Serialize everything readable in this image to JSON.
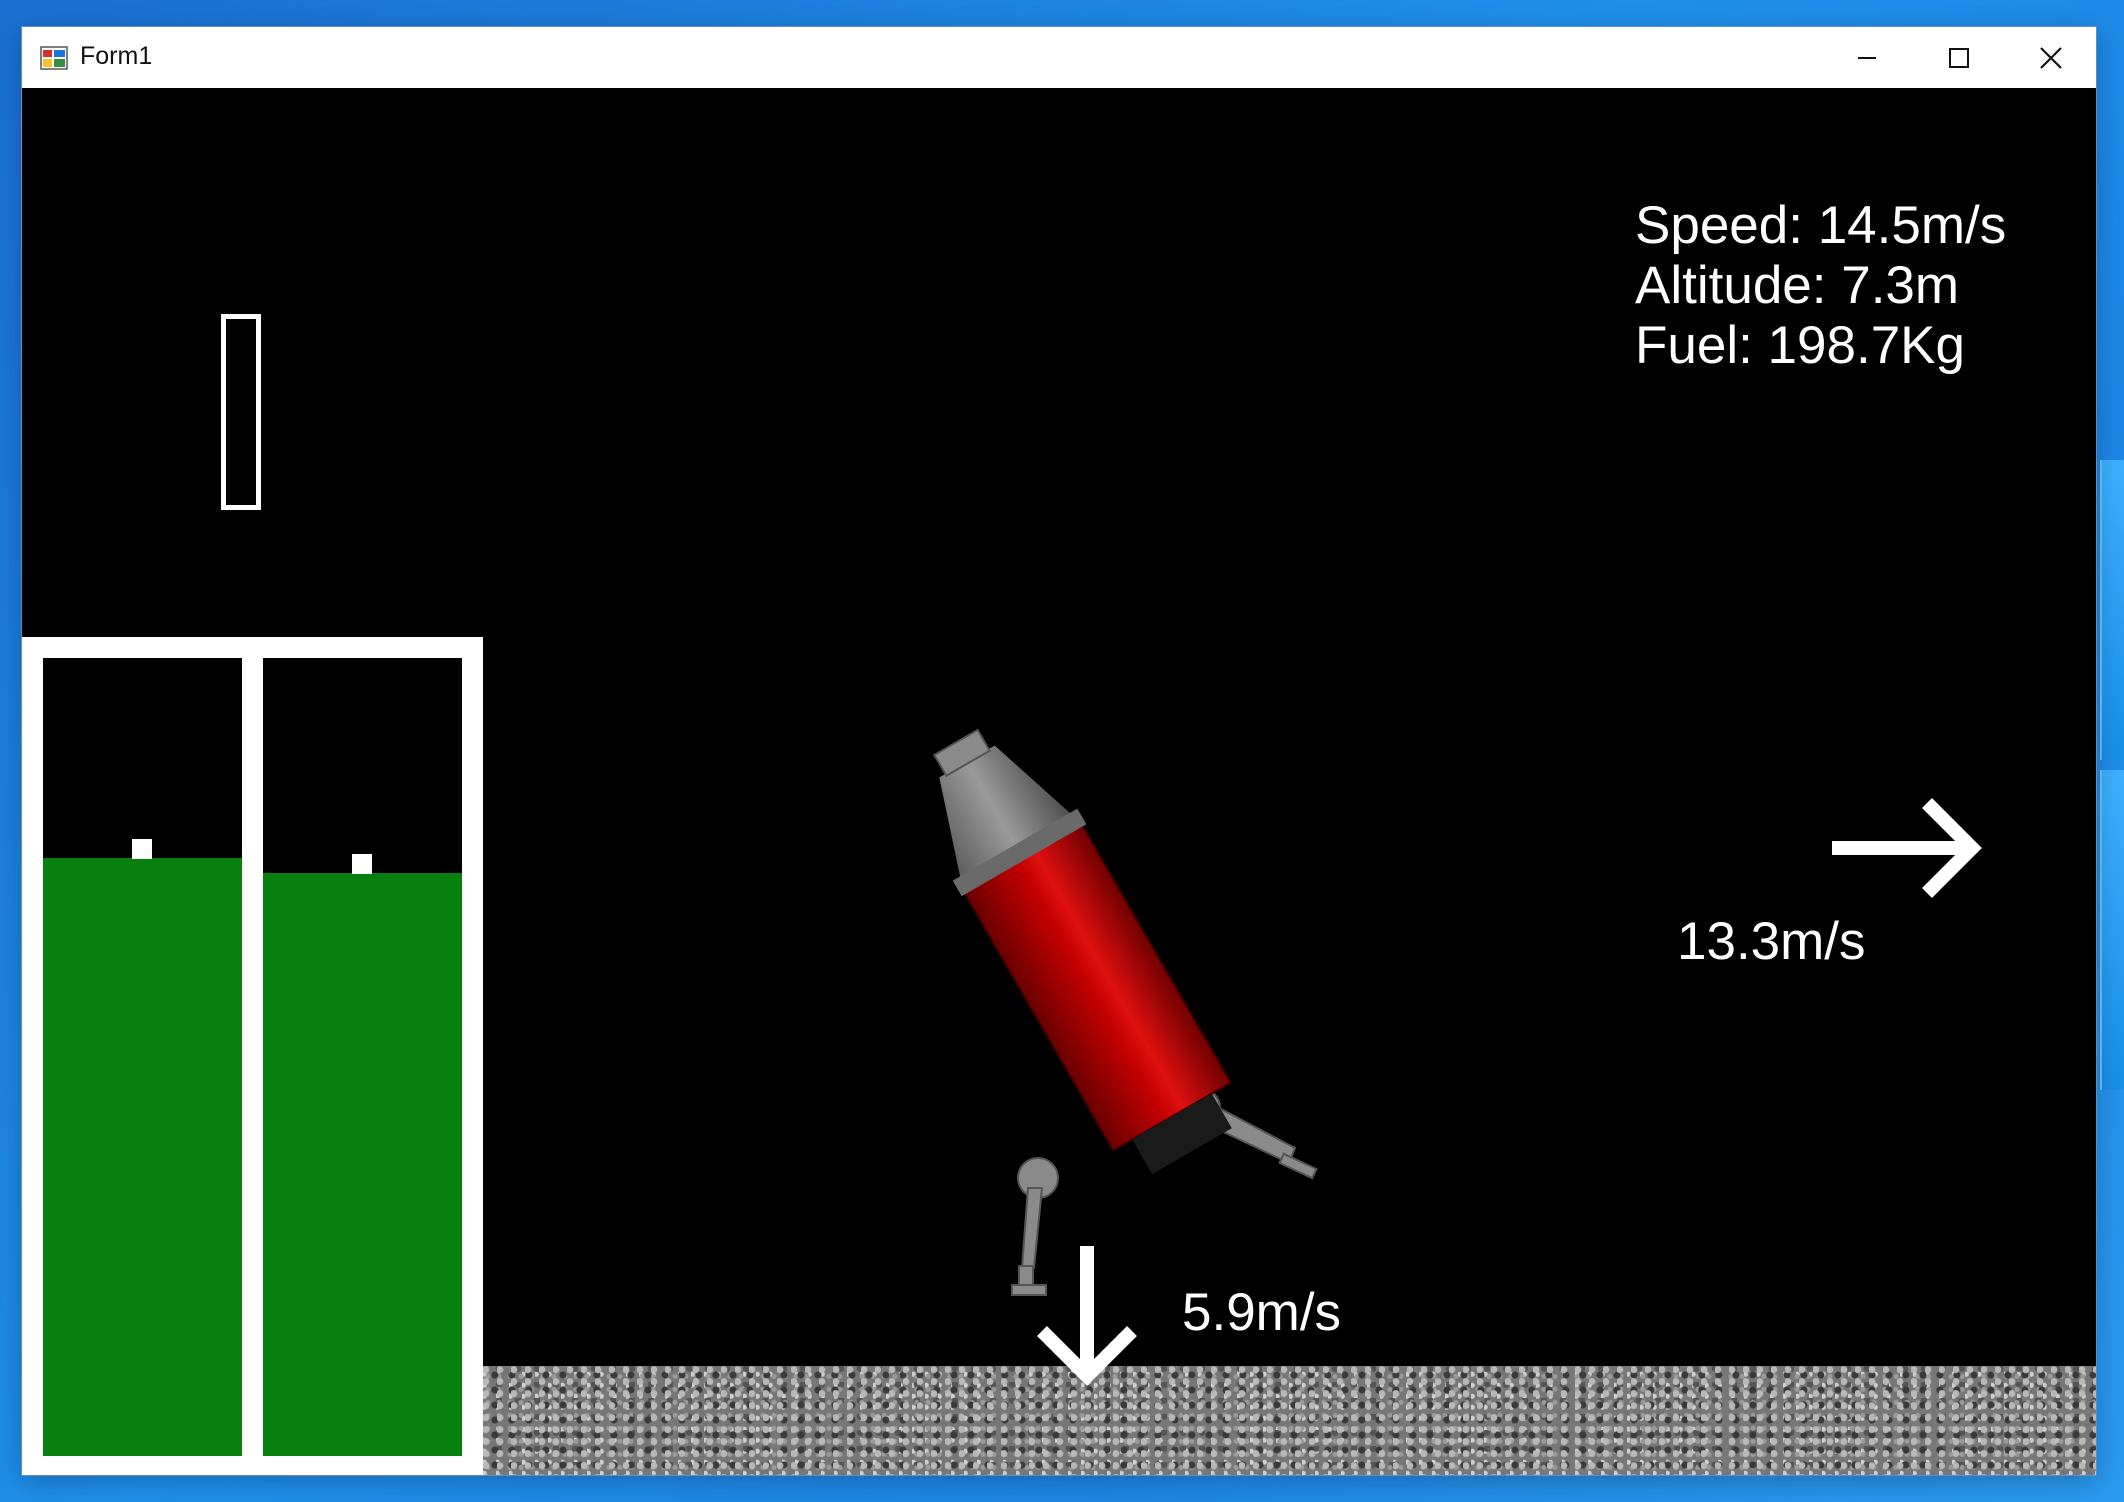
{
  "window": {
    "title": "Form1",
    "controls": {
      "minimize": "minimize",
      "maximize": "maximize",
      "close": "close"
    }
  },
  "hud": {
    "speed": "Speed: 14.5m/s",
    "altitude": "Altitude: 7.3m",
    "fuel": "Fuel: 198.7Kg"
  },
  "velocity": {
    "horizontal_label": "13.3m/s",
    "vertical_label": "5.9m/s"
  },
  "tanks": [
    {
      "name": "left-tank",
      "level_fraction": 0.75
    },
    {
      "name": "right-tank",
      "level_fraction": 0.73
    }
  ],
  "colors": {
    "sky": "#000000",
    "tank_fill": "#08800f",
    "rocket_body": "#b00000",
    "rocket_nose": "#7a7a7a"
  },
  "icons": {
    "app": "app-form-icon",
    "arrow_right": "arrow-right-icon",
    "arrow_down": "arrow-down-icon"
  }
}
